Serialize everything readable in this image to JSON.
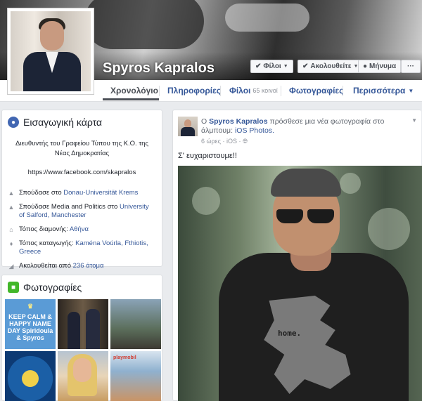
{
  "profile": {
    "name": "Spyros Kapralos"
  },
  "cover_buttons": {
    "friends": {
      "label": "Φίλοι",
      "icon": "check-icon"
    },
    "following": {
      "label": "Ακολουθείτε",
      "icon": "check-icon"
    },
    "message": {
      "label": "Μήνυμα",
      "icon": "messenger-icon"
    },
    "more": {
      "label": "···"
    }
  },
  "nav": {
    "tabs": [
      {
        "label": "Χρονολόγιο"
      },
      {
        "label": "Πληροφορίες"
      },
      {
        "label": "Φίλοι",
        "count": "65 κοινοί"
      },
      {
        "label": "Φωτογραφίες"
      },
      {
        "label": "Περισσότερα"
      }
    ]
  },
  "intro": {
    "title": "Εισαγωγική κάρτα",
    "bio": "Διευθυντής του Γραφείου Τύπου της Κ.Ο. της Νέας Δημοκρατίας",
    "link": "https://www.facebook.com/skapralos",
    "items": [
      {
        "prefix": "Σπούδασε στο ",
        "link": "Donau-Universität Krems",
        "suffix": ""
      },
      {
        "prefix": "Σπούδασε Media and Politics στο ",
        "link": "University of Salford, Manchester",
        "suffix": ""
      },
      {
        "prefix": "Τόπος διαμονής: ",
        "link": "Αθήνα",
        "suffix": ""
      },
      {
        "prefix": "Τόπος καταγωγής: ",
        "link": "Kaména Voúrla, Fthiotis, Greece",
        "suffix": ""
      },
      {
        "prefix": "Ακολουθείται από ",
        "link": "236 άτομα",
        "suffix": ""
      }
    ]
  },
  "photos_card": {
    "title": "Φωτογραφίες",
    "tile1_text": "KEEP CALM & HAPPY NAME DAY Spiridoula & Spyros",
    "tile6_label": "playmobil"
  },
  "post": {
    "prefix": "Ο ",
    "author": "Spyros Kapralos",
    "action": " πρόσθεσε μια νέα φωτογραφία στο άλμπουμ: ",
    "album": "iOS Photos.",
    "time": "6 ώρες · iOS · ",
    "text": "Σ' ευχαριστουμε!!",
    "shirt_text": "home."
  },
  "colors": {
    "fb_blue": "#365899",
    "background": "#e9ebee"
  }
}
